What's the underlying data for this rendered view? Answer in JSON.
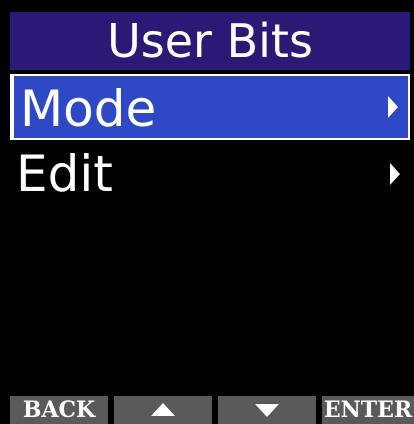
{
  "title": "User Bits",
  "menu": {
    "items": [
      {
        "label": "Mode",
        "selected": true,
        "has_submenu": true
      },
      {
        "label": "Edit",
        "selected": false,
        "has_submenu": true
      }
    ]
  },
  "softkeys": {
    "back": "BACK",
    "up_icon": "triangle-up-icon",
    "down_icon": "triangle-down-icon",
    "enter": "ENTER"
  },
  "colors": {
    "title_bg": "#2b1a75",
    "selected_bg": "#2f49c6",
    "softkey_bg": "#5a5a5a",
    "background": "#000000",
    "text": "#ffffff"
  }
}
